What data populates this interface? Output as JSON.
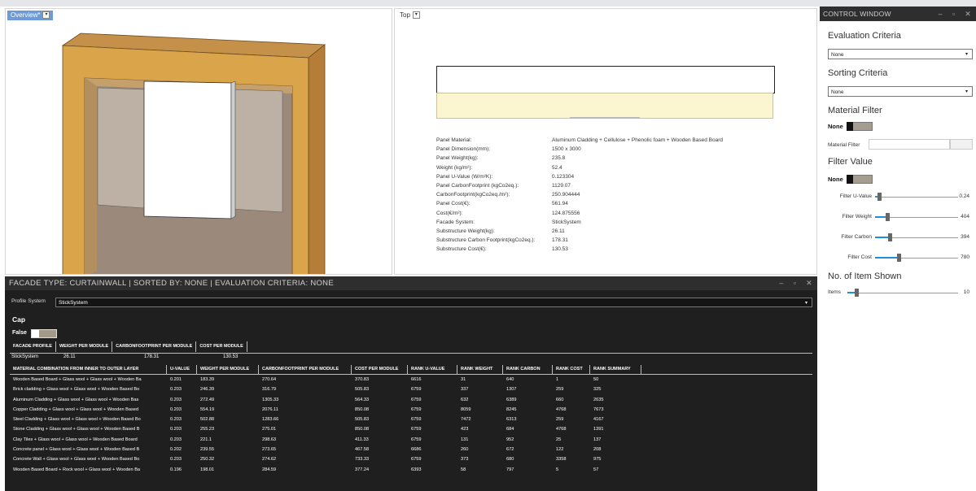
{
  "left_view": {
    "tab_label": "Overview*"
  },
  "right_view": {
    "tab_label": "Top",
    "properties": [
      {
        "key": "Panel Material:",
        "value": "Aluminum Cladding + Cellulose + Phenolic foam + Wooden Based Board"
      },
      {
        "key": "Panel Dimension(mm):",
        "value": "1500 x 3000"
      },
      {
        "key": "Panel Weight(kg):",
        "value": "235.8"
      },
      {
        "key": "Weight (kg/m²):",
        "value": "52.4"
      },
      {
        "key": "Panel U-Value (W/m²K):",
        "value": "0.123304"
      },
      {
        "key": "Panel CarbonFootprint (kgCo2eq.):",
        "value": "1129.07"
      },
      {
        "key": "CarbonFootprint(kgCo2eq./m²):",
        "value": "250.904444"
      },
      {
        "key": "Panel Cost(€):",
        "value": "561.94"
      },
      {
        "key": "Cost(€/m²):",
        "value": "124.875556"
      },
      {
        "key": "Facade System:",
        "value": "StickSystem"
      },
      {
        "key": "Substructure Weight(kg):",
        "value": "26.11"
      },
      {
        "key": "Substructure Carbon Footprint(kgCo2eq.):",
        "value": "178.31"
      },
      {
        "key": "Substructure Cost(€):",
        "value": "130.53"
      }
    ]
  },
  "facade_panel": {
    "title": "FACADE TYPE: CURTAINWALL  |  SORTED BY: NONE | EVALUATION CRITERIA: NONE",
    "profile_system_label": "Profile System",
    "profile_system_value": "StickSystem",
    "cap_label": "Cap",
    "cap_toggle_label": "False",
    "profile_headers": [
      "FACADE PROFILE",
      "WEIGHT PER MODULE",
      "CARBONFOOTPRINT PER MODULE",
      "COST PER MODULE"
    ],
    "profile_row": [
      "StickSystem",
      "26.11",
      "178.31",
      "130.53"
    ],
    "table_headers": [
      "MATERIAL COMBINATION FROM INNER TO OUTER LAYER",
      "U-VALUE",
      "WEIGHT PER MODULE",
      "CARBONFOOTPRINT PER MODULE",
      "COST PER MODULE",
      "RANK U-VALUE",
      "RANK WEIGHT",
      "RANK CARBON",
      "RANK COST",
      "RANK SUMMARY"
    ],
    "rows": [
      [
        "Wooden Based Board + Glass wool + Glass wool + Wooden Ba",
        "0.201",
        "183.39",
        "270.64",
        "370.83",
        "6616",
        "31",
        "640",
        "1",
        "50"
      ],
      [
        "Brick cladding + Glass wool + Glass wool + Wooden Based Bo",
        "0.203",
        "246.39",
        "316.79",
        "505.83",
        "6759",
        "337",
        "1307",
        "259",
        "325"
      ],
      [
        "Aluminum Cladding + Glass wool + Glass wool + Wooden Bas",
        "0.203",
        "272.49",
        "1305.33",
        "564.33",
        "6759",
        "632",
        "6389",
        "660",
        "2635"
      ],
      [
        "Copper Cladding + Glass wool + Glass wool + Wooden Based",
        "0.203",
        "554.19",
        "2076.11",
        "850.08",
        "6759",
        "8059",
        "8245",
        "4768",
        "7673"
      ],
      [
        "Steel Cladding + Glass wool + Glass wool + Wooden Based Bo",
        "0.203",
        "502.88",
        "1283.66",
        "505.83",
        "6759",
        "7472",
        "6313",
        "259",
        "4167"
      ],
      [
        "Stone Cladding + Glass wool + Glass wool + Wooden Based B",
        "0.203",
        "255.23",
        "275.01",
        "850.08",
        "6759",
        "423",
        "684",
        "4768",
        "1391"
      ],
      [
        "Clay Tiles + Glass wool + Glass wool + Wooden Based Board",
        "0.203",
        "221.1",
        "298.63",
        "411.33",
        "6759",
        "131",
        "952",
        "25",
        "137"
      ],
      [
        "Concrete panel  + Glass wool + Glass wool + Wooden Based B",
        "0.202",
        "239.55",
        "273.65",
        "467.58",
        "6686",
        "260",
        "672",
        "122",
        "208"
      ],
      [
        "Concrete Wall + Glass wool + Glass wool + Wooden Based Bo",
        "0.203",
        "250.32",
        "274.62",
        "733.33",
        "6759",
        "373",
        "680",
        "3358",
        "975"
      ],
      [
        "Wooden Based Board + Rock wool + Glass wool + Wooden Ba",
        "0.196",
        "198.01",
        "284.59",
        "377.24",
        "6393",
        "58",
        "797",
        "5",
        "57"
      ]
    ]
  },
  "control_window": {
    "title": "CONTROL WINDOW",
    "evaluation_criteria_label": "Evaluation Criteria",
    "evaluation_criteria_value": "None",
    "sorting_criteria_label": "Sorting Criteria",
    "sorting_criteria_value": "None",
    "material_filter_label": "Material Filter",
    "material_filter_toggle": "None",
    "material_filter_field_label": "Material Filter",
    "filter_value_label": "Filter Value",
    "filter_value_toggle": "None",
    "sliders": [
      {
        "label": "Filter U-Value",
        "value": "0.24",
        "fraction": 0.05
      },
      {
        "label": "Filter Weight",
        "value": "404",
        "fraction": 0.15
      },
      {
        "label": "Filter Carbon",
        "value": "394",
        "fraction": 0.18
      },
      {
        "label": "Filter Cost",
        "value": "780",
        "fraction": 0.28
      }
    ],
    "items_shown_label": "No. of Item Shown",
    "items_slider": {
      "label": "Items",
      "value": "10",
      "fraction": 0.08
    }
  },
  "colors": {
    "accent_blue": "#1c90d9",
    "dark_panel": "#1f1f1f",
    "wood": "#d9a44a",
    "glass_yellow": "#fbf6d0"
  }
}
